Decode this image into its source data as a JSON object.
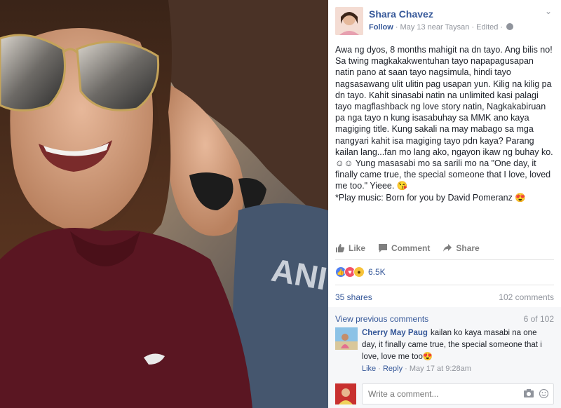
{
  "post": {
    "author": "Shara Chavez",
    "follow_label": "Follow",
    "meta": "· May 13 near Taysan · Edited ·",
    "text": "Awa ng dyos, 8 months mahigit na dn tayo. Ang bilis no! Sa twing magkakakwentuhan tayo napapagusapan natin pano at saan tayo nagsimula, hindi tayo nagsasawang ulit ulitin pag usapan yun. Kilig na kilig pa dn tayo. Kahit sinasabi natin na unlimited kasi palagi tayo magflashback ng love story natin, Nagkakabiruan pa nga tayo n kung isasabuhay sa MMK ano kaya magiging title. Kung sakali na may mabago sa mga nangyari kahit isa magiging tayo pdn kaya? Parang kailan lang...fan mo lang ako, ngayon ikaw ng buhay ko. ☺☺ Yung masasabi mo sa sarili mo na \"One day, it finally came true, the special someone that I love, loved me too.\" Yieee. 😘\n*Play music: Born for you by David Pomeranz 😍"
  },
  "actions": {
    "like": "Like",
    "comment": "Comment",
    "share": "Share"
  },
  "reactions": {
    "count": "6.5K"
  },
  "stats": {
    "shares": "35 shares",
    "comments": "102 comments"
  },
  "comments": {
    "view_previous": "View previous comments",
    "position": "6 of 102",
    "items": [
      {
        "name": "Cherry May Paug",
        "text": "kailan ko kaya masabi na one day, it finally came true, the special someone that i love, love me too😍",
        "like": "Like",
        "reply": "Reply",
        "time": "· May 17 at 9:28am"
      }
    ],
    "write_placeholder": "Write a comment..."
  },
  "photo": {
    "shirt_print": "ANI S, AL"
  },
  "colors": {
    "link": "#365899",
    "muted": "#90949c",
    "text": "#1d2129"
  }
}
